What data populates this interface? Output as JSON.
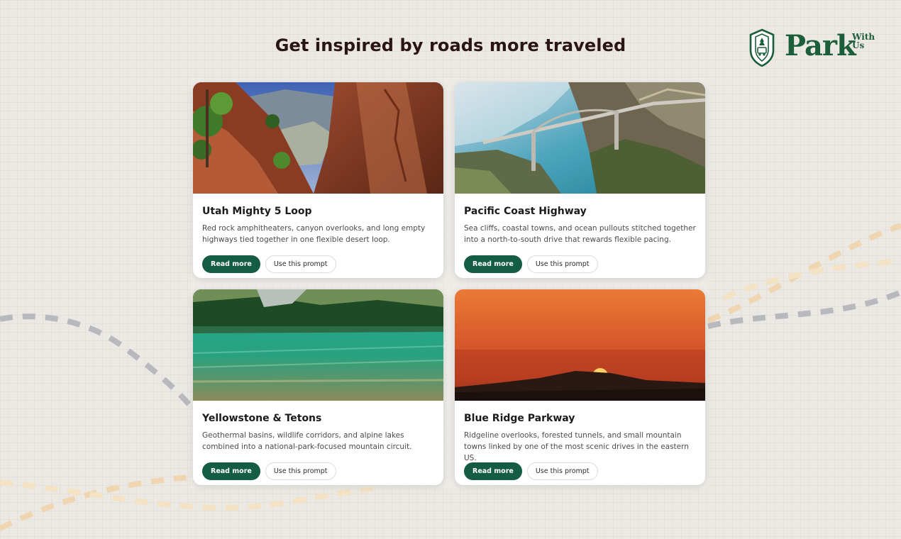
{
  "page": {
    "heading": "Get inspired by roads more traveled"
  },
  "logo": {
    "wordmark": "Park",
    "sub_line1": "With",
    "sub_line2": "Us",
    "color": "#1d5e3a"
  },
  "colors": {
    "primary_button": "#145c44",
    "road_gray": "#b7b9bf",
    "road_tan": "#efd6b1"
  },
  "cards": [
    {
      "title": "Utah Mighty 5 Loop",
      "description": "Red rock amphitheaters, canyon overlooks, and long empty highways tied together in one flexible desert loop.",
      "primary_label": "Read more",
      "secondary_label": "Use this prompt",
      "image": "canyon-photo"
    },
    {
      "title": "Pacific Coast Highway",
      "description": "Sea cliffs, coastal towns, and ocean pullouts stitched together into a north-to-south drive that rewards flexible pacing.",
      "primary_label": "Read more",
      "secondary_label": "Use this prompt",
      "image": "coastal-bridge-photo"
    },
    {
      "title": "Yellowstone & Tetons",
      "description": "Geothermal basins, wildlife corridors, and alpine lakes combined into a national-park-focused mountain circuit.",
      "primary_label": "Read more",
      "secondary_label": "Use this prompt",
      "image": "alpine-lake-photo"
    },
    {
      "title": "Blue Ridge Parkway",
      "description": "Ridgeline overlooks, forested tunnels, and small mountain towns linked by one of the most scenic drives in the eastern US.",
      "primary_label": "Read more",
      "secondary_label": "Use this prompt",
      "image": "mountain-sunset-photo"
    }
  ]
}
